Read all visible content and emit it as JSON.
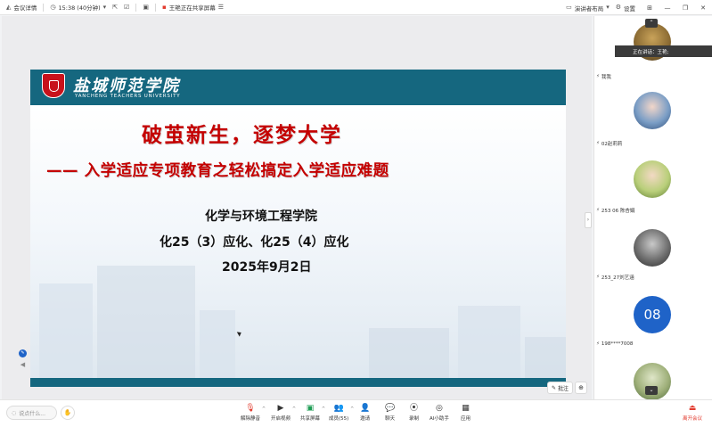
{
  "topbar": {
    "meeting_details": "会议详情",
    "time": "15:38 (40分钟)",
    "sharing_status": "王艳正在共享屏幕",
    "layout_label": "演讲者布局",
    "settings_label": "设置"
  },
  "slide": {
    "school_cn": "盐城师范学院",
    "school_en": "YANCHENG TEACHERS UNIVERSITY",
    "title_main": "破茧新生，逐梦大学",
    "title_sub": "—— 入学适应专项教育之轻松搞定入学适应难题",
    "college": "化学与环境工程学院",
    "classes": "化25（3）应化、化25（4）应化",
    "date": "2025年9月2日"
  },
  "stage_tools": {
    "annotate_label": "批注"
  },
  "participants": {
    "speaking_tip": "正在讲话：王艳;",
    "tiles": [
      {
        "name": "我我"
      },
      {
        "name": "02赵莉莉"
      },
      {
        "name": "253 06 陈杏娟"
      },
      {
        "name": "253_27刘艺涵"
      },
      {
        "name": "198****7008",
        "initials": "08"
      }
    ]
  },
  "bottombar": {
    "chat_placeholder": "说点什么...",
    "unmute": "解除静音",
    "video": "开启视频",
    "share": "共享屏幕",
    "members": "成员(55)",
    "invite": "邀请",
    "chat": "聊天",
    "record": "录制",
    "ai_assistant": "AI小助手",
    "apps": "应用",
    "leave": "离开会议"
  },
  "colors": {
    "header_teal": "#15677f",
    "title_red": "#c40000",
    "accent_blue": "#1f63c8",
    "leave_red": "#e23b2e"
  }
}
